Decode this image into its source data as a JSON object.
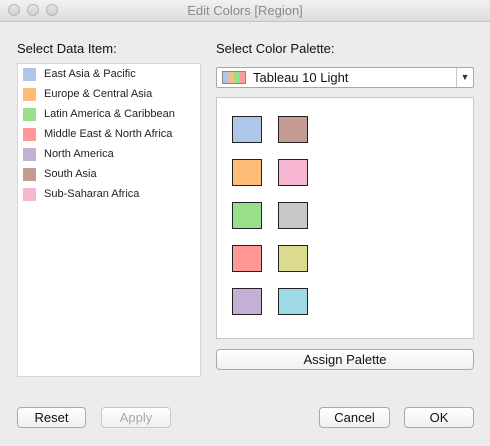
{
  "window": {
    "title": "Edit Colors [Region]"
  },
  "left": {
    "label": "Select Data Item:",
    "items": [
      {
        "label": "East Asia & Pacific",
        "color": "#aec7e8"
      },
      {
        "label": "Europe & Central Asia",
        "color": "#ffbb78"
      },
      {
        "label": "Latin America & Caribbean",
        "color": "#98df8a"
      },
      {
        "label": "Middle East & North Africa",
        "color": "#ff9896"
      },
      {
        "label": "North America",
        "color": "#c5b0d5"
      },
      {
        "label": "South Asia",
        "color": "#c49c94"
      },
      {
        "label": "Sub-Saharan Africa",
        "color": "#f7b6d2"
      }
    ]
  },
  "right": {
    "label": "Select Color Palette:",
    "selected_palette": "Tableau 10 Light",
    "swatches": [
      "#aec7e8",
      "#c49c94",
      "#ffbb78",
      "#f7b6d2",
      "#98df8a",
      "#c7c7c7",
      "#ff9896",
      "#dbdb8d",
      "#c5b0d5",
      "#9edae5"
    ],
    "assign_label": "Assign Palette"
  },
  "buttons": {
    "reset": "Reset",
    "apply": "Apply",
    "cancel": "Cancel",
    "ok": "OK"
  }
}
